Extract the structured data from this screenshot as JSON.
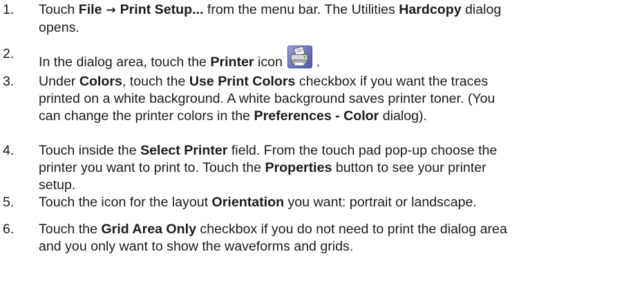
{
  "steps": [
    {
      "number": "1.",
      "lines": [
        [
          {
            "t": "Touch ",
            "b": false
          },
          {
            "t": "File",
            "b": true
          },
          {
            "t": " → ",
            "b": true,
            "arrow": true
          },
          {
            "t": "Print Setup...",
            "b": true
          },
          {
            "t": " from the menu bar. The Utilities ",
            "b": false
          },
          {
            "t": "Hardcopy",
            "b": true
          },
          {
            "t": " dialog",
            "b": false
          }
        ],
        [
          {
            "t": "opens.",
            "b": false
          }
        ]
      ]
    },
    {
      "number": "2.",
      "lines": [
        [
          {
            "t": "In the dialog area, touch the ",
            "b": false
          },
          {
            "t": "Printer",
            "b": true
          },
          {
            "t": " icon ",
            "b": false
          },
          {
            "icon": "printer-icon"
          },
          {
            "t": ".",
            "b": false
          }
        ]
      ]
    },
    {
      "number": "3.",
      "lines": [
        [
          {
            "t": "Under ",
            "b": false
          },
          {
            "t": "Colors",
            "b": true
          },
          {
            "t": ", touch the ",
            "b": false
          },
          {
            "t": "Use Print Colors",
            "b": true
          },
          {
            "t": " checkbox if you want the traces",
            "b": false
          }
        ],
        [
          {
            "t": "printed on a white background. A white background saves printer toner. (You",
            "b": false
          }
        ],
        [
          {
            "t": "can change the printer colors in the ",
            "b": false
          },
          {
            "t": "Preferences - Color",
            "b": true
          },
          {
            "t": " dialog).",
            "b": false
          }
        ]
      ]
    },
    {
      "number": "4.",
      "lines": [
        [
          {
            "t": "Touch inside the ",
            "b": false
          },
          {
            "t": "Select Printer",
            "b": true
          },
          {
            "t": " field. From the touch pad pop-up choose the",
            "b": false
          }
        ],
        [
          {
            "t": "printer you want to print to. Touch the ",
            "b": false
          },
          {
            "t": "Properties",
            "b": true
          },
          {
            "t": " button to see your printer",
            "b": false
          }
        ],
        [
          {
            "t": "setup.",
            "b": false
          }
        ]
      ]
    },
    {
      "number": "5.",
      "lines": [
        [
          {
            "t": "Touch the icon for the layout ",
            "b": false
          },
          {
            "t": "Orientation",
            "b": true
          },
          {
            "t": " you want: portrait or landscape.",
            "b": false
          }
        ]
      ]
    },
    {
      "number": "6.",
      "lines": [
        [
          {
            "t": "Touch the ",
            "b": false
          },
          {
            "t": "Grid Area Only",
            "b": true
          },
          {
            "t": " checkbox if you do not need to print the dialog area",
            "b": false
          }
        ],
        [
          {
            "t": "and you only want to show the waveforms and grids.",
            "b": false
          }
        ]
      ]
    }
  ]
}
